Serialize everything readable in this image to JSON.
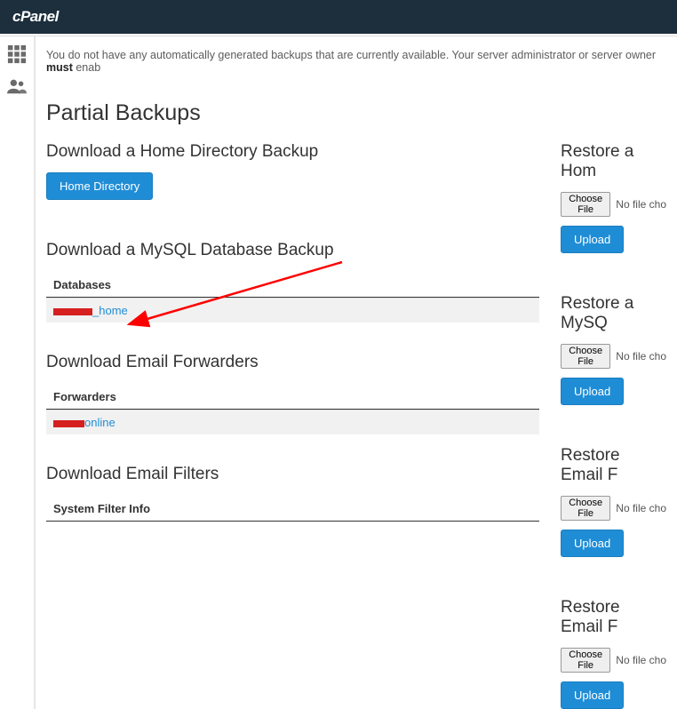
{
  "logo": "cPanel",
  "notice": {
    "pre": "You do not have any automatically generated backups that are currently available. Your server administrator or server owner ",
    "strong": "must",
    "post": " enab"
  },
  "heading": "Partial Backups",
  "left": {
    "home_title": "Download a Home Directory Backup",
    "home_btn": "Home Directory",
    "mysql_title": "Download a MySQL Database Backup",
    "mysql_th": "Databases",
    "mysql_link_rest": "_home",
    "fwd_title": "Download Email Forwarders",
    "fwd_th": "Forwarders",
    "fwd_link_rest": "online",
    "filter_title": "Download Email Filters",
    "filter_th": "System Filter Info"
  },
  "right": {
    "home_title": "Restore a Hom",
    "mysql_title": "Restore a MySQ",
    "fwd_title": "Restore Email F",
    "filter_title": "Restore Email F",
    "choose_file": "Choose File",
    "no_file": "No file cho",
    "upload_btn": "Upload"
  }
}
